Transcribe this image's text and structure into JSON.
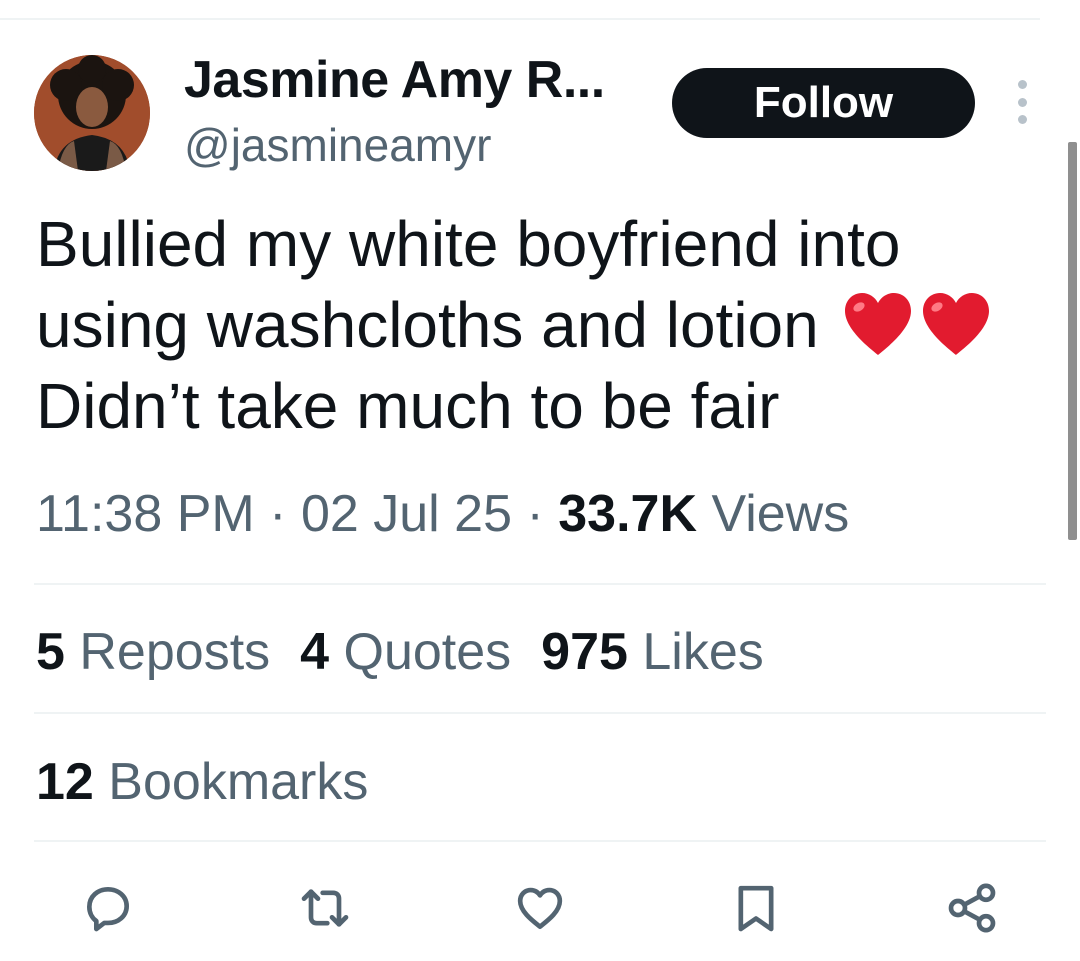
{
  "author": {
    "display_name": "Jasmine Amy R...",
    "handle": "@jasmineamyr",
    "avatar_icon": "profile-photo"
  },
  "follow_label": "Follow",
  "more_icon": "more-vertical-icon",
  "tweet": {
    "lines": [
      "Bullied my white boyfriend into",
      "using washcloths and lotion",
      "Didn’t take much to be fair"
    ],
    "emoji": [
      "red-heart",
      "red-heart"
    ]
  },
  "meta": {
    "time": "11:38 PM",
    "separator": "·",
    "date": "02 Jul 25",
    "views_count": "33.7K",
    "views_label": "Views"
  },
  "stats": {
    "reposts": {
      "count": "5",
      "label": "Reposts"
    },
    "quotes": {
      "count": "4",
      "label": "Quotes"
    },
    "likes": {
      "count": "975",
      "label": "Likes"
    },
    "bookmarks": {
      "count": "12",
      "label": "Bookmarks"
    }
  },
  "actions": [
    "reply-icon",
    "repost-icon",
    "like-icon",
    "bookmark-icon",
    "share-icon"
  ],
  "colors": {
    "text_primary": "#0f1419",
    "text_secondary": "#536471",
    "icon": "#536471",
    "heart": "#e0245e",
    "follow_bg": "#0f1419"
  }
}
